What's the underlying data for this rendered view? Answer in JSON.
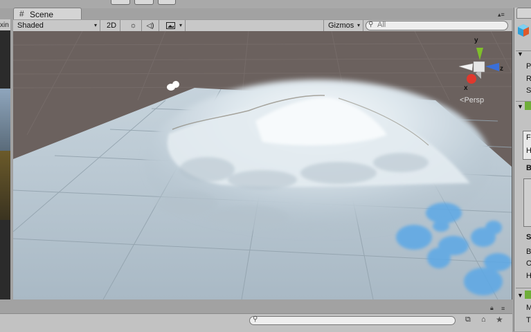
{
  "scene_tab": {
    "label": "Scene"
  },
  "left_panel": {
    "label": "xin"
  },
  "toolbar": {
    "shading_mode": "Shaded",
    "mode_2d": "2D",
    "gizmos_label": "Gizmos",
    "search_placeholder": "All"
  },
  "gizmo": {
    "x_label": "x",
    "y_label": "y",
    "z_label": "z",
    "projection": "Persp"
  },
  "inspector_letters": [
    "P",
    "R",
    "S",
    "F",
    "H",
    "B",
    "S",
    "B",
    "O",
    "H",
    "M",
    "T"
  ],
  "colors": {
    "sky": "#6b615e",
    "ground": "#a9b7c2",
    "gizmo_x": "#e0382d",
    "gizmo_y": "#7fbf2a",
    "gizmo_z": "#3a6fd8",
    "water": "#5ca8e6"
  },
  "icons": [
    "play-icon",
    "pause-icon",
    "step-icon",
    "lighting-icon",
    "audio-icon",
    "effects-icon",
    "search-icon",
    "layers-icon",
    "tag-icon",
    "star-icon",
    "lock-icon",
    "menu-icon"
  ]
}
